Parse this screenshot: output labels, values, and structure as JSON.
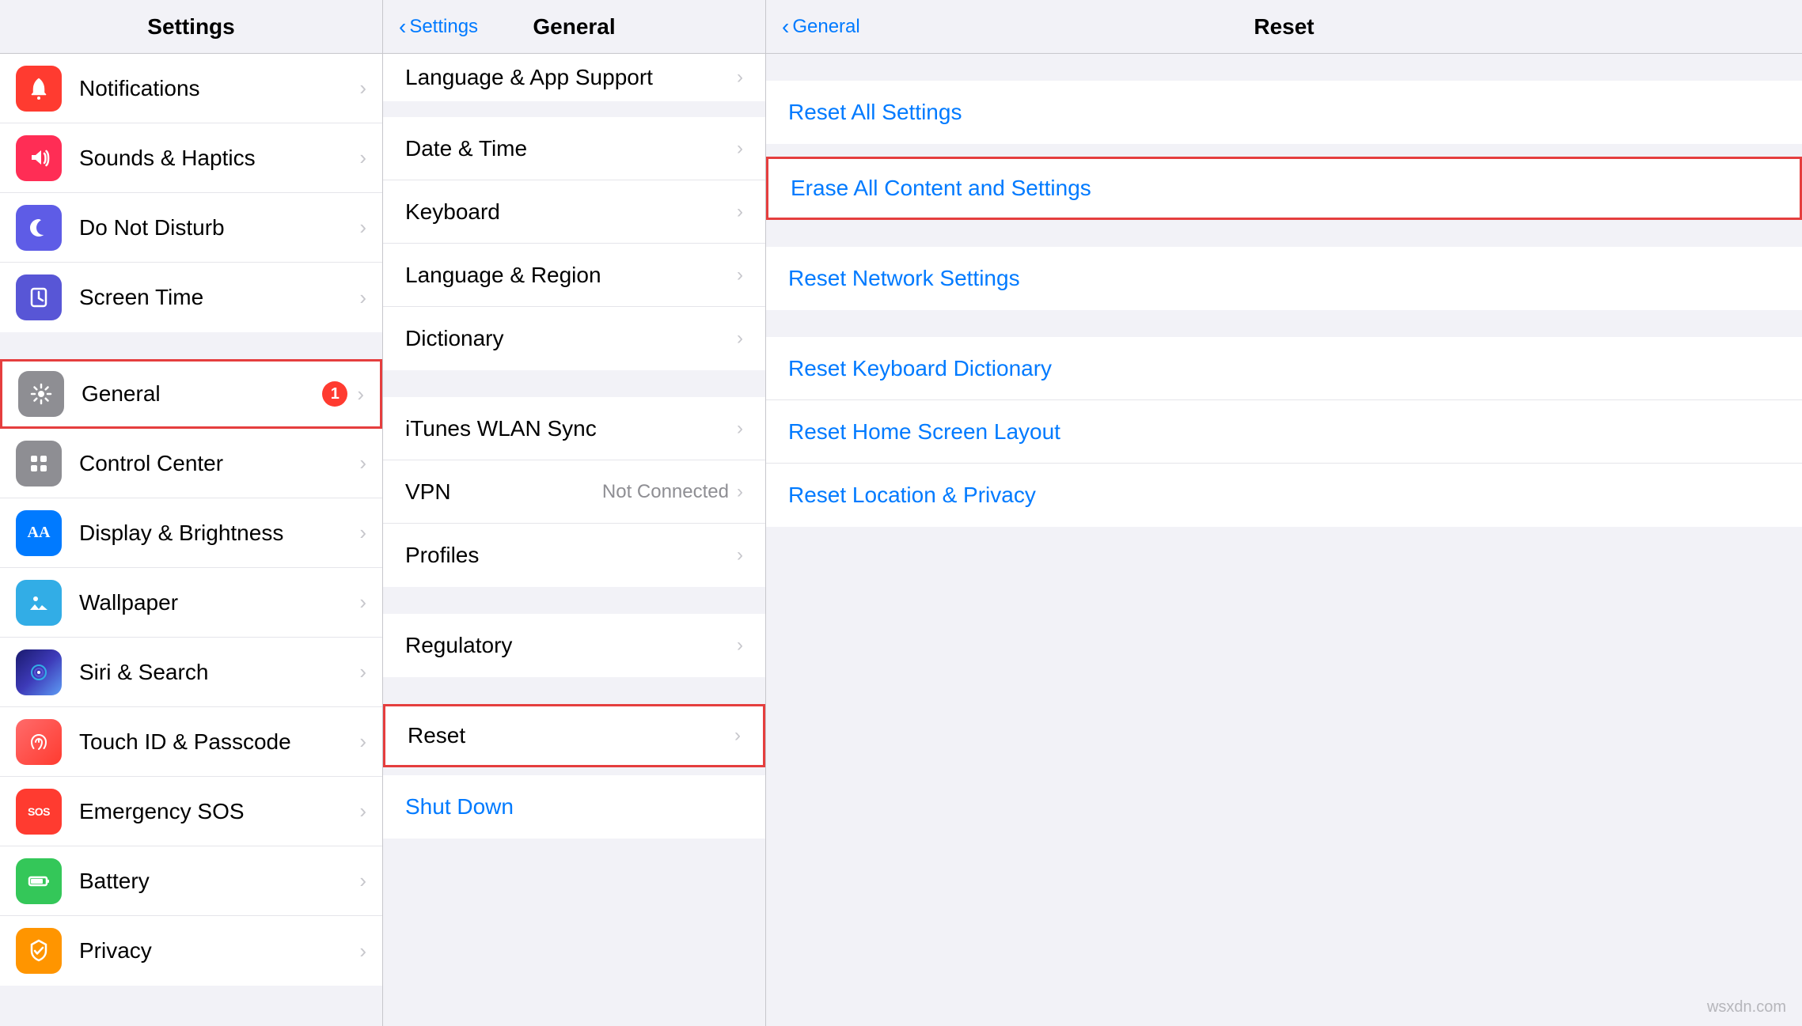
{
  "left_column": {
    "title": "Settings",
    "items_group1": [
      {
        "id": "notifications",
        "label": "Notifications",
        "icon_char": "🔔",
        "icon_bg": "bg-red",
        "badge": null
      },
      {
        "id": "sounds",
        "label": "Sounds & Haptics",
        "icon_char": "🔊",
        "icon_bg": "bg-pink",
        "badge": null
      },
      {
        "id": "donotdisturb",
        "label": "Do Not Disturb",
        "icon_char": "🌙",
        "icon_bg": "bg-purple2",
        "badge": null
      },
      {
        "id": "screentime",
        "label": "Screen Time",
        "icon_char": "⏳",
        "icon_bg": "bg-purple",
        "badge": null
      }
    ],
    "items_group2": [
      {
        "id": "general",
        "label": "General",
        "icon_char": "⚙️",
        "icon_bg": "bg-gray",
        "badge": "1",
        "highlighted": true
      },
      {
        "id": "controlcenter",
        "label": "Control Center",
        "icon_char": "⊞",
        "icon_bg": "bg-gray",
        "badge": null
      },
      {
        "id": "displaybrightness",
        "label": "Display & Brightness",
        "icon_char": "AA",
        "icon_bg": "bg-blue",
        "badge": null
      },
      {
        "id": "wallpaper",
        "label": "Wallpaper",
        "icon_char": "🌸",
        "icon_bg": "bg-teal",
        "badge": null
      },
      {
        "id": "siri",
        "label": "Siri & Search",
        "icon_char": "◎",
        "icon_bg": "bg-siri",
        "badge": null
      },
      {
        "id": "touchid",
        "label": "Touch ID & Passcode",
        "icon_char": "✦",
        "icon_bg": "bg-touch",
        "badge": null
      },
      {
        "id": "emergencysos",
        "label": "Emergency SOS",
        "icon_char": "SOS",
        "icon_bg": "bg-sos",
        "badge": null
      },
      {
        "id": "battery",
        "label": "Battery",
        "icon_char": "🔋",
        "icon_bg": "bg-battery",
        "badge": null
      },
      {
        "id": "privacy",
        "label": "Privacy",
        "icon_char": "✋",
        "icon_bg": "bg-privacy",
        "badge": null
      }
    ]
  },
  "mid_column": {
    "back_label": "Settings",
    "title": "General",
    "items_top": [
      {
        "id": "language_app",
        "label": "Language & App Support",
        "value": null
      }
    ],
    "group1": [
      {
        "id": "datetime",
        "label": "Date & Time",
        "value": null
      },
      {
        "id": "keyboard",
        "label": "Keyboard",
        "value": null
      },
      {
        "id": "language_region",
        "label": "Language & Region",
        "value": null
      },
      {
        "id": "dictionary",
        "label": "Dictionary",
        "value": null
      }
    ],
    "group2": [
      {
        "id": "itunes_wlan",
        "label": "iTunes WLAN Sync",
        "value": null
      },
      {
        "id": "vpn",
        "label": "VPN",
        "value": "Not Connected"
      },
      {
        "id": "profiles",
        "label": "Profiles",
        "value": null
      }
    ],
    "group3": [
      {
        "id": "regulatory",
        "label": "Regulatory",
        "value": null
      }
    ],
    "group4": [
      {
        "id": "reset",
        "label": "Reset",
        "value": null,
        "highlighted": true
      }
    ],
    "shutdown": {
      "id": "shutdown",
      "label": "Shut Down",
      "is_link": true
    }
  },
  "right_column": {
    "back_label": "General",
    "title": "Reset",
    "group1": [
      {
        "id": "reset_all_settings",
        "label": "Reset All Settings"
      }
    ],
    "group2": [
      {
        "id": "erase_all",
        "label": "Erase All Content and Settings",
        "highlighted": true
      }
    ],
    "group3": [
      {
        "id": "reset_network",
        "label": "Reset Network Settings"
      }
    ],
    "group4": [
      {
        "id": "reset_keyboard",
        "label": "Reset Keyboard Dictionary"
      },
      {
        "id": "reset_home_screen",
        "label": "Reset Home Screen Layout"
      },
      {
        "id": "reset_location",
        "label": "Reset Location & Privacy"
      }
    ]
  },
  "watermark": "wsxdn.com"
}
